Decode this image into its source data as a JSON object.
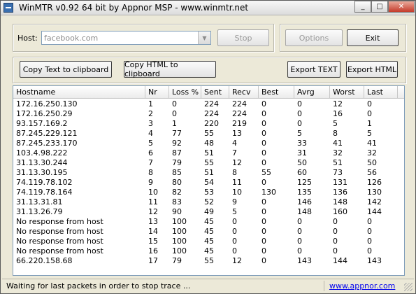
{
  "window": {
    "title": "WinMTR v0.92 64 bit by Appnor MSP - www.winmtr.net"
  },
  "controls": {
    "minimize": "_",
    "maximize": "□",
    "close": "✕"
  },
  "host": {
    "label": "Host:",
    "value": "facebook.com",
    "stop_label": "Stop"
  },
  "buttons": {
    "options": "Options",
    "exit": "Exit",
    "copy_text": "Copy Text to clipboard",
    "copy_html": "Copy HTML to clipboard",
    "export_text": "Export TEXT",
    "export_html": "Export HTML"
  },
  "table": {
    "columns": [
      "Hostname",
      "Nr",
      "Loss %",
      "Sent",
      "Recv",
      "Best",
      "Avrg",
      "Worst",
      "Last"
    ],
    "rows": [
      [
        "172.16.250.130",
        "1",
        "0",
        "224",
        "224",
        "0",
        "0",
        "12",
        "0"
      ],
      [
        "172.16.250.29",
        "2",
        "0",
        "224",
        "224",
        "0",
        "0",
        "16",
        "0"
      ],
      [
        "93.157.169.2",
        "3",
        "1",
        "220",
        "219",
        "0",
        "0",
        "5",
        "1"
      ],
      [
        "87.245.229.121",
        "4",
        "77",
        "55",
        "13",
        "0",
        "5",
        "8",
        "5"
      ],
      [
        "87.245.233.170",
        "5",
        "92",
        "48",
        "4",
        "0",
        "33",
        "41",
        "41"
      ],
      [
        "103.4.98.222",
        "6",
        "87",
        "51",
        "7",
        "0",
        "31",
        "32",
        "32"
      ],
      [
        "31.13.30.244",
        "7",
        "79",
        "55",
        "12",
        "0",
        "50",
        "51",
        "50"
      ],
      [
        "31.13.30.195",
        "8",
        "85",
        "51",
        "8",
        "55",
        "60",
        "73",
        "56"
      ],
      [
        "74.119.78.102",
        "9",
        "80",
        "54",
        "11",
        "0",
        "125",
        "131",
        "126"
      ],
      [
        "74.119.78.164",
        "10",
        "82",
        "53",
        "10",
        "130",
        "135",
        "136",
        "130"
      ],
      [
        "31.13.31.81",
        "11",
        "83",
        "52",
        "9",
        "0",
        "146",
        "148",
        "142"
      ],
      [
        "31.13.26.79",
        "12",
        "90",
        "49",
        "5",
        "0",
        "148",
        "160",
        "144"
      ],
      [
        "No response from host",
        "13",
        "100",
        "45",
        "0",
        "0",
        "0",
        "0",
        "0"
      ],
      [
        "No response from host",
        "14",
        "100",
        "45",
        "0",
        "0",
        "0",
        "0",
        "0"
      ],
      [
        "No response from host",
        "15",
        "100",
        "45",
        "0",
        "0",
        "0",
        "0",
        "0"
      ],
      [
        "No response from host",
        "16",
        "100",
        "45",
        "0",
        "0",
        "0",
        "0",
        "0"
      ],
      [
        "66.220.158.68",
        "17",
        "79",
        "55",
        "12",
        "0",
        "143",
        "144",
        "143"
      ]
    ]
  },
  "status": {
    "text": "Waiting for last packets in order to stop trace ...",
    "link": "www.appnor.com"
  }
}
